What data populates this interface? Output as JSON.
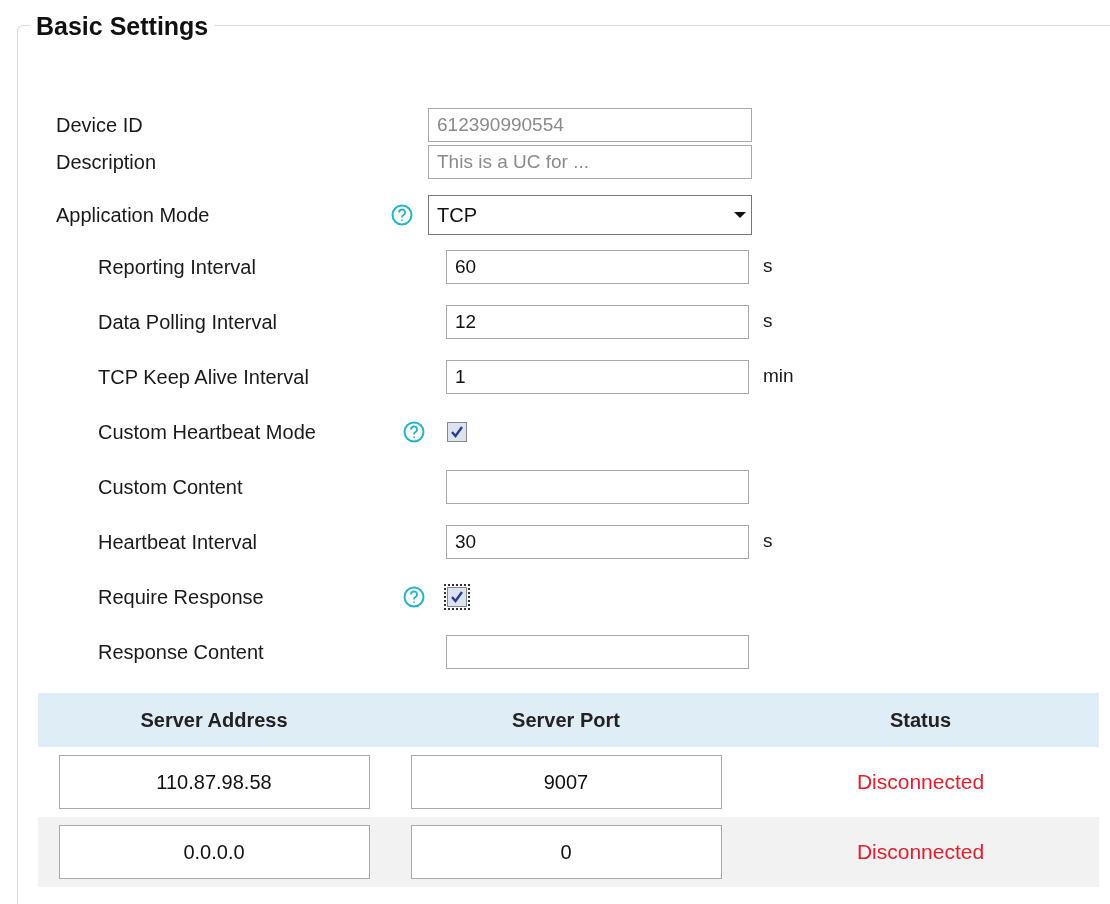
{
  "section": {
    "title": "Basic Settings"
  },
  "fields": [
    {
      "kind": "text",
      "label": "Device ID",
      "value": "612390990554",
      "disabled": true
    },
    {
      "kind": "text",
      "label": "Description",
      "value": "This is a UC for ...",
      "disabled": true
    },
    {
      "kind": "select",
      "label": "Application Mode",
      "value": "TCP",
      "help": true,
      "children": [
        {
          "kind": "text",
          "label": "Reporting Interval",
          "value": "60",
          "unit": "s"
        },
        {
          "kind": "text",
          "label": "Data Polling Interval",
          "value": "12",
          "unit": "s"
        },
        {
          "kind": "text",
          "label": "TCP Keep Alive Interval",
          "value": "1",
          "unit": "min"
        },
        {
          "kind": "checkbox",
          "label": "Custom Heartbeat Mode",
          "checked": true,
          "help": true
        },
        {
          "kind": "text",
          "label": "Custom Content"
        },
        {
          "kind": "text",
          "label": "Heartbeat Interval",
          "value": "30",
          "unit": "s"
        },
        {
          "kind": "checkbox",
          "label": "Require Response",
          "checked": true,
          "focused": true,
          "help": true
        },
        {
          "kind": "text",
          "label": "Response Content"
        }
      ]
    }
  ],
  "servers": {
    "columns": [
      "Server Address",
      "Server Port",
      "Status"
    ],
    "rows": [
      {
        "address": "110.87.98.58",
        "port": "9007",
        "status": "Disconnected",
        "connected": false
      },
      {
        "address": "0.0.0.0",
        "port": "0",
        "status": "Disconnected",
        "connected": false
      }
    ]
  }
}
